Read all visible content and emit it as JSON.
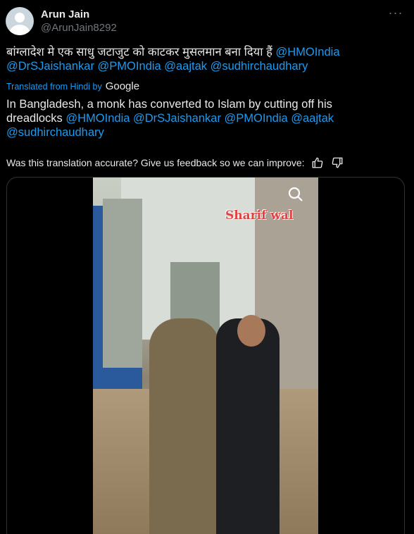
{
  "user": {
    "name": "Arun Jain",
    "handle": "@ArunJain8292"
  },
  "tweet": {
    "hindi_text": "बांग्लादेश मे एक साधु जटाजुट को काटकर मुसलमान बना दिया हैं",
    "hindi_mentions": "@HMOIndia",
    "hindi_mentions_line2": "@DrSJaishankar @PMOIndia @aajtak @sudhirchaudhary",
    "translated_label": "Translated from Hindi by",
    "translator": "Google",
    "english_text_line1": "In Bangladesh, a monk has converted to Islam by cutting off his",
    "english_text_line2_prefix": "dreadlocks",
    "english_mentions_line2": "@HMOIndia @DrSJaishankar @PMOIndia @aajtak",
    "english_mentions_line3": "@sudhirchaudhary",
    "feedback_prompt": "Was this translation accurate? Give us feedback so we can improve:"
  },
  "media": {
    "overlay_caption": "Sharif wal"
  },
  "colors": {
    "link": "#1d9bf0",
    "background": "#000000",
    "text": "#e7e9ea",
    "secondary_text": "#71767b"
  }
}
